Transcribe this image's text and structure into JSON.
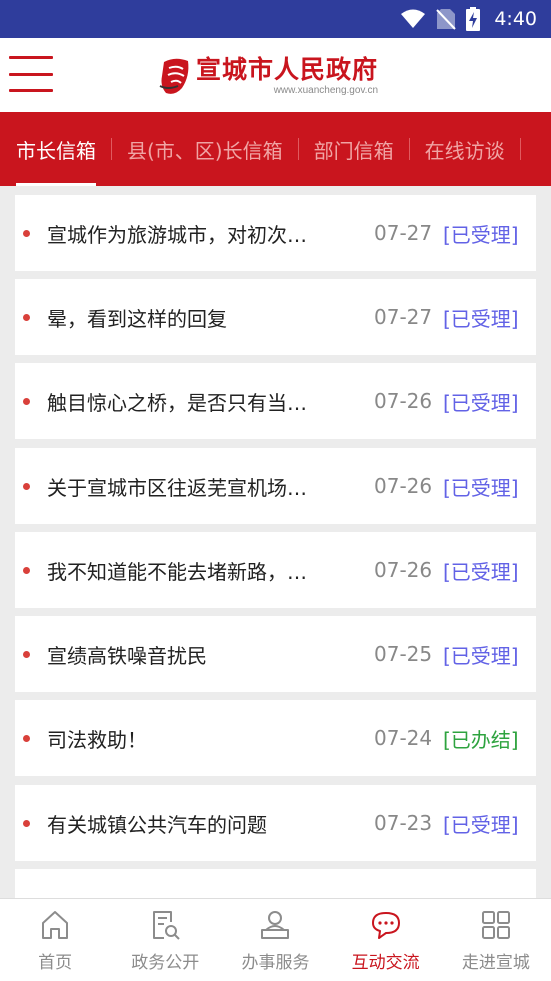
{
  "status_bar": {
    "time": "4:40"
  },
  "header": {
    "site_title": "宣城市人民政府",
    "site_url": "www.xuancheng.gov.cn"
  },
  "tabs": [
    {
      "label": "市长信箱",
      "active": true
    },
    {
      "label": "县(市、区)长信箱",
      "active": false
    },
    {
      "label": "部门信箱",
      "active": false
    },
    {
      "label": "在线访谈",
      "active": false
    }
  ],
  "letters": [
    {
      "title": "宣城作为旅游城市，对初次…",
      "date": "07-27",
      "status": "[已受理]",
      "status_type": "accepted"
    },
    {
      "title": "晕，看到这样的回复",
      "date": "07-27",
      "status": "[已受理]",
      "status_type": "accepted"
    },
    {
      "title": "触目惊心之桥，是否只有当…",
      "date": "07-26",
      "status": "[已受理]",
      "status_type": "accepted"
    },
    {
      "title": "关于宣城市区往返芜宣机场…",
      "date": "07-26",
      "status": "[已受理]",
      "status_type": "accepted"
    },
    {
      "title": "我不知道能不能去堵新路，…",
      "date": "07-26",
      "status": "[已受理]",
      "status_type": "accepted"
    },
    {
      "title": "宣绩高铁噪音扰民",
      "date": "07-25",
      "status": "[已受理]",
      "status_type": "accepted"
    },
    {
      "title": "司法救助！",
      "date": "07-24",
      "status": "[已办结]",
      "status_type": "done"
    },
    {
      "title": "有关城镇公共汽车的问题",
      "date": "07-23",
      "status": "[已受理]",
      "status_type": "accepted"
    },
    {
      "title": "",
      "date": "",
      "status": "",
      "status_type": "accepted"
    }
  ],
  "bottom_nav": [
    {
      "label": "首页",
      "icon": "home-icon",
      "active": false
    },
    {
      "label": "政务公开",
      "icon": "document-search-icon",
      "active": false
    },
    {
      "label": "办事服务",
      "icon": "service-person-icon",
      "active": false
    },
    {
      "label": "互动交流",
      "icon": "chat-bubble-icon",
      "active": true
    },
    {
      "label": "走进宣城",
      "icon": "grid-icon",
      "active": false
    }
  ],
  "colors": {
    "status_bar": "#2f3d9c",
    "brand_red": "#c9151e",
    "accepted": "#6262e6",
    "done": "#2ea33f"
  }
}
